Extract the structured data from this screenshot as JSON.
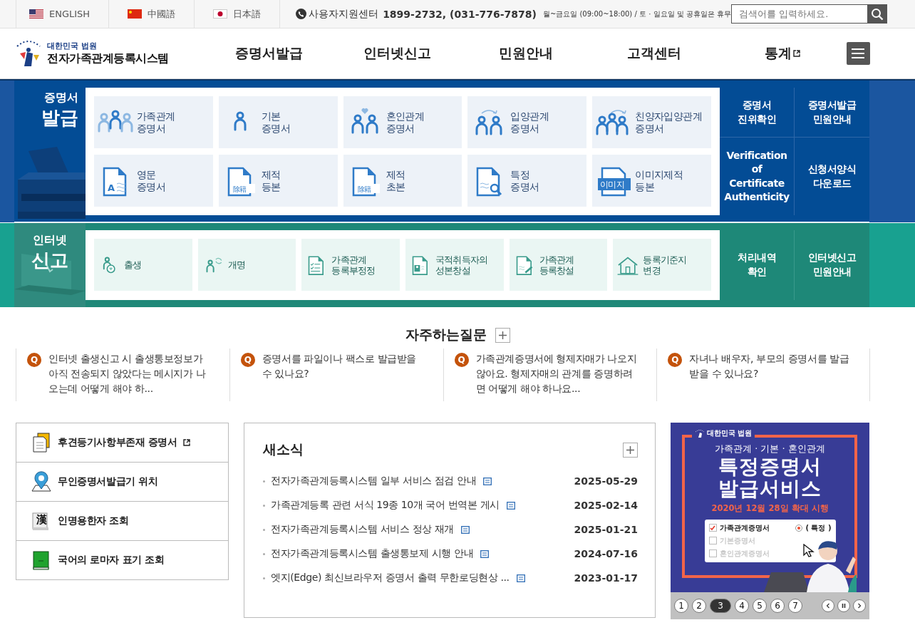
{
  "top_bar": {
    "languages": [
      {
        "label": "ENGLISH",
        "kind": "us"
      },
      {
        "label": "中國語",
        "kind": "cn"
      },
      {
        "label": "日本語",
        "kind": "jp"
      }
    ],
    "support": {
      "label": "사용자지원센터",
      "phone": "1899-2732, (031-776-7878)",
      "hours": "월~금요일 (09:00~18:00) / 토 · 일요일 및 공휴일은 휴무"
    },
    "search": {
      "placeholder": "검색어를 입력하세요."
    }
  },
  "header": {
    "org": "대한민국 법원",
    "title": "전자가족관계등록시스템",
    "nav": [
      {
        "label": "증명서발급",
        "external": false
      },
      {
        "label": "인터넷신고",
        "external": false
      },
      {
        "label": "민원안내",
        "external": false
      },
      {
        "label": "고객센터",
        "external": false
      },
      {
        "label": "통계",
        "external": true
      }
    ]
  },
  "certificate_section": {
    "title_small": "증명서",
    "title_large": "발급",
    "tiles": [
      {
        "label": "가족관계\n증명서",
        "kind": "family"
      },
      {
        "label": "기본\n증명서",
        "kind": "person"
      },
      {
        "label": "혼인관계\n증명서",
        "kind": "marriage"
      },
      {
        "label": "입양관계\n증명서",
        "kind": "adoption"
      },
      {
        "label": "친양자입양관계\n증명서",
        "kind": "family-adoption"
      },
      {
        "label": "영문\n증명서",
        "kind": "english-doc",
        "icon_text": "A"
      },
      {
        "label": "제적\n등본",
        "kind": "stamp-doc",
        "icon_text": "除籍"
      },
      {
        "label": "제적\n초본",
        "kind": "stamp-doc",
        "icon_text": "除籍"
      },
      {
        "label": "특정\n증명서",
        "kind": "search-doc"
      },
      {
        "label": "이미지제적\n등본",
        "kind": "image-doc",
        "icon_text": "이미지"
      }
    ],
    "links": [
      "증명서\n진위확인",
      "증명서발급\n민원안내",
      "Verification of\nCertificate\nAuthenticity",
      "신청서양식\n다운로드"
    ]
  },
  "report_section": {
    "title_small": "인터넷",
    "title_large": "신고",
    "tiles": [
      {
        "label": "출생",
        "kind": "birth"
      },
      {
        "label": "개명",
        "kind": "rename"
      },
      {
        "label": "가족관계\n등록부정정",
        "kind": "check-doc"
      },
      {
        "label": "국적취득자의\n성본창설",
        "kind": "person-doc"
      },
      {
        "label": "가족관계\n등록창설",
        "kind": "pen-doc"
      },
      {
        "label": "등록기준지\n변경",
        "kind": "house"
      }
    ],
    "links": [
      "처리내역\n확인",
      "인터넷신고\n민원안내"
    ]
  },
  "faq": {
    "title": "자주하는질문",
    "items": [
      {
        "badge": "Q",
        "text": "인터넷 출생신고 시 출생통보정보가 아직 전송되지 않았다는 메시지가 나오는데 어떻게 해야 하..."
      },
      {
        "badge": "Q",
        "text": "증명서를 파일이나 팩스로 발급받을 수 있나요?"
      },
      {
        "badge": "Q",
        "text": "가족관계증명서에 형제자매가 나오지 않아요. 형제자매의 관계를 증명하려면 어떻게 해야 하나요..."
      },
      {
        "badge": "Q",
        "text": "자녀나 배우자, 부모의 증명서를 발급 받을 수 있나요?"
      }
    ]
  },
  "quick_links": [
    {
      "label": "후견등기사항부존재 증명서",
      "kind": "docs",
      "external": true
    },
    {
      "label": "무인증명서발급기 위치",
      "kind": "pin",
      "external": false
    },
    {
      "label": "인명용한자 조회",
      "kind": "hanja-book",
      "icon_text": "漢",
      "external": false
    },
    {
      "label": "국어의 로마자 표기 조회",
      "kind": "green-book",
      "external": false
    }
  ],
  "news": {
    "title": "새소식",
    "items": [
      {
        "title": "전자가족관계등록시스템 일부 서비스 점검 안내",
        "date": "2025-05-29"
      },
      {
        "title": "가족관계등록 관련 서식 19종 10개 국어 번역본 게시",
        "date": "2025-02-14"
      },
      {
        "title": "전자가족관계등록시스템 서비스 정상 재개",
        "date": "2025-01-21"
      },
      {
        "title": "전자가족관계등록시스템 출생통보제 시행 안내",
        "date": "2024-07-16"
      },
      {
        "title": "엣지(Edge) 최신브라우저 증명서 출력 무한로딩현상 ...",
        "date": "2023-01-17"
      }
    ]
  },
  "banner": {
    "org": "대한민국 법원",
    "subtitle": "가족관계 · 기본 · 혼인관계",
    "headline": "특정증명서\n발급서비스",
    "notice": "2020년 12월 28일 확대 시행",
    "checklist": [
      {
        "label": "가족관계증명서",
        "checked": true,
        "option": "( 특정 )",
        "option_selected": true
      },
      {
        "label": "기본증명서",
        "checked": false
      },
      {
        "label": "혼인관계증명서",
        "checked": false
      }
    ],
    "pages": [
      {
        "label": "1",
        "selected": false
      },
      {
        "label": "2",
        "selected": false
      },
      {
        "label": "3",
        "selected": true
      },
      {
        "label": "4",
        "selected": false
      },
      {
        "label": "5",
        "selected": false
      },
      {
        "label": "6",
        "selected": false
      },
      {
        "label": "7",
        "selected": false
      }
    ]
  }
}
